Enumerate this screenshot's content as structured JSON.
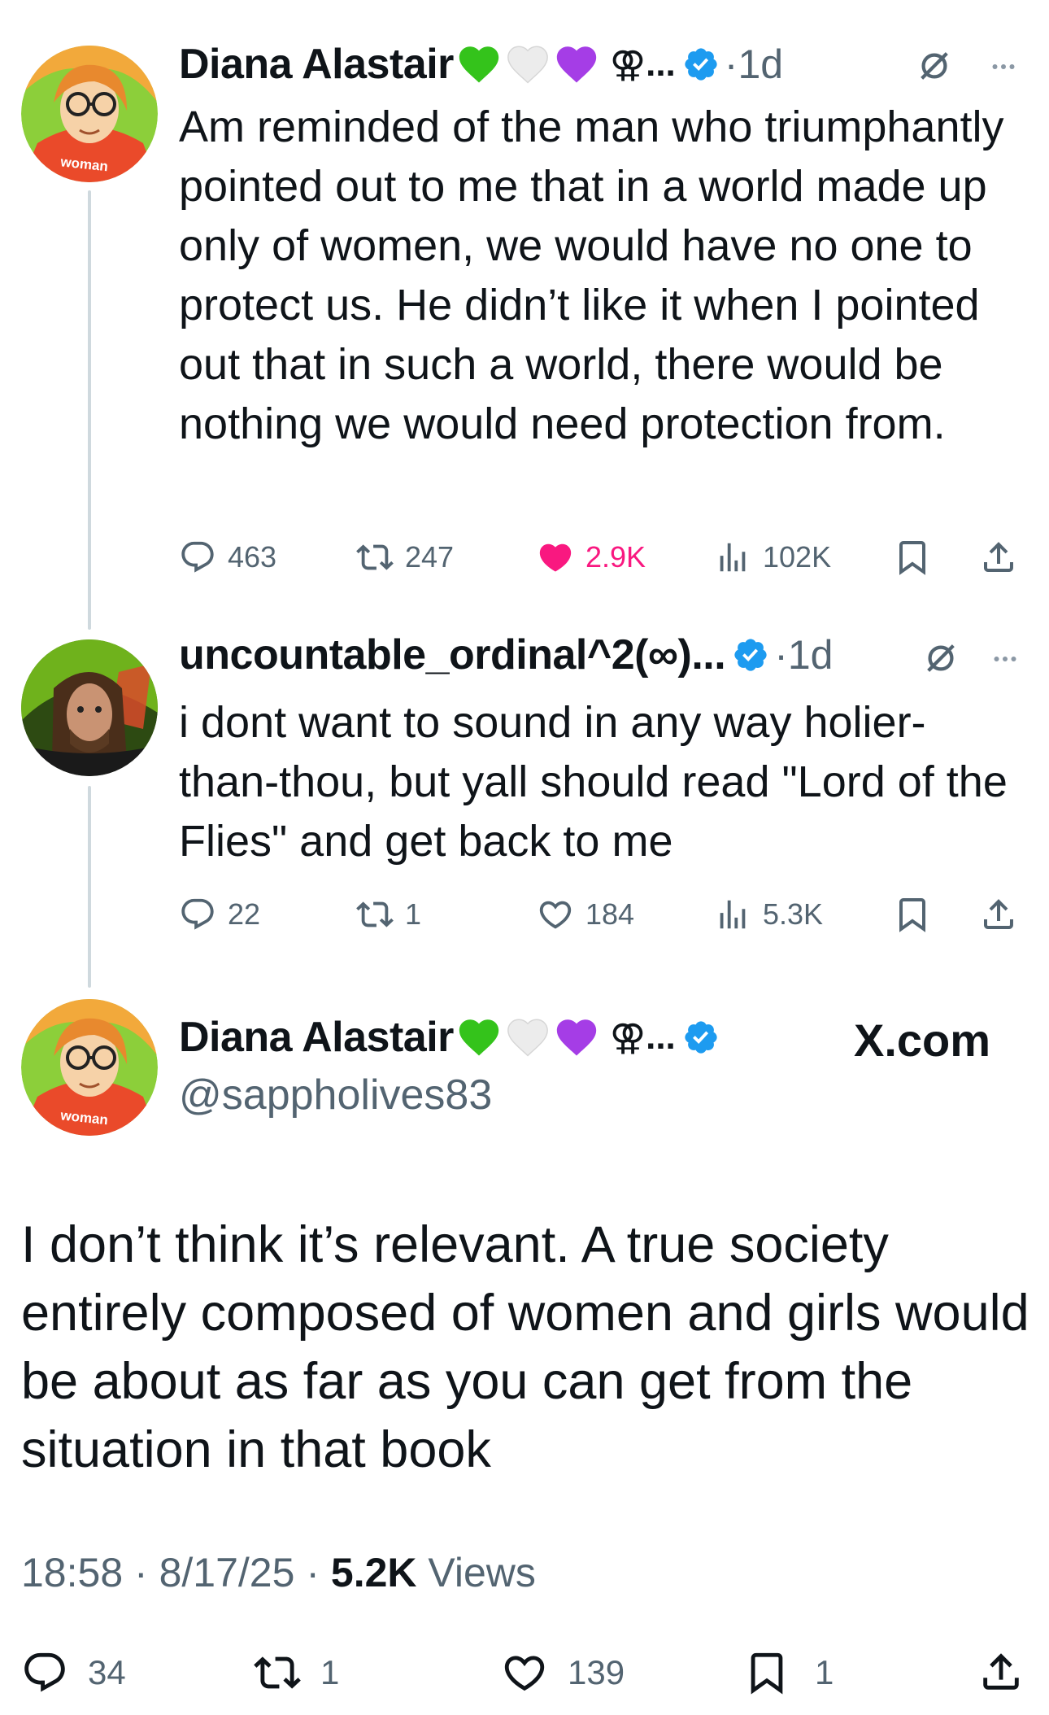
{
  "tweets": [
    {
      "name": "Diana Alastair",
      "emojis": [
        "green-heart",
        "white-heart",
        "purple-heart"
      ],
      "symbol": "⚢",
      "ellipsis": "...",
      "dot": "·",
      "age": "1d",
      "text": "Am reminded of the man who triumphantly pointed out to me that in a world made up only of women, we would have no one to protect us. He didn’t like it when I pointed out that in such a world, there would be nothing we would need protection from.",
      "avatar_badge": "woman",
      "replies": "463",
      "reposts": "247",
      "likes": "2.9K",
      "views": "102K",
      "liked": true
    },
    {
      "name": "uncountable_ordinal^2(∞)...",
      "dot": "·",
      "age": "1d",
      "text": "i dont want to sound in any way holier-than-thou, but yall should read \"Lord of the Flies\" and get back to me",
      "replies": "22",
      "reposts": "1",
      "likes": "184",
      "views": "5.3K",
      "liked": false
    }
  ],
  "main": {
    "name": "Diana Alastair",
    "symbol": "⚢",
    "ellipsis": "...",
    "handle": "@sappholives83",
    "avatar_badge": "woman",
    "watermark": "X.com",
    "text": "I don’t think it’s relevant. A true society entirely composed of women and girls would be about as far as you can get from the situation in that book",
    "time": "18:58",
    "sep": "·",
    "date": "8/17/25",
    "views_count": "5.2K",
    "views_label": "Views",
    "replies": "34",
    "reposts": "1",
    "likes": "139",
    "bookmarks": "1"
  },
  "colors": {
    "text": "#0f1419",
    "secondary": "#536471",
    "verified": "#1d9bf0",
    "like_active": "#f91880",
    "thread_line": "#cfd9de"
  }
}
